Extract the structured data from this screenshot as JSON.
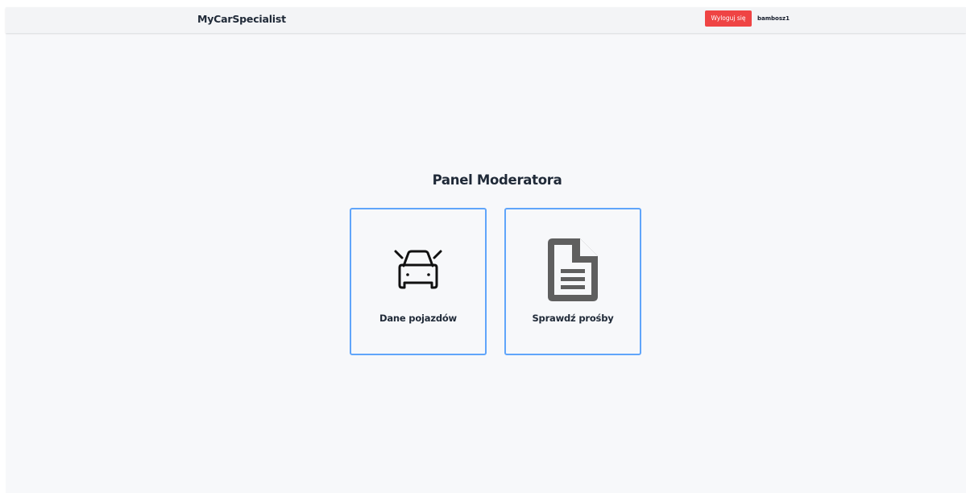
{
  "header": {
    "brand": "MyCarSpecialist",
    "logout_label": "Wyloguj się",
    "username": "bambosz1"
  },
  "main": {
    "title": "Panel Moderatora",
    "cards": [
      {
        "label": "Dane pojazdów",
        "icon": "car-icon"
      },
      {
        "label": "Sprawdź prośby",
        "icon": "document-icon"
      }
    ]
  },
  "colors": {
    "accent": "#60a5fa",
    "danger": "#ef4444",
    "background": "#f7f8fa",
    "text": "#1f2937"
  }
}
